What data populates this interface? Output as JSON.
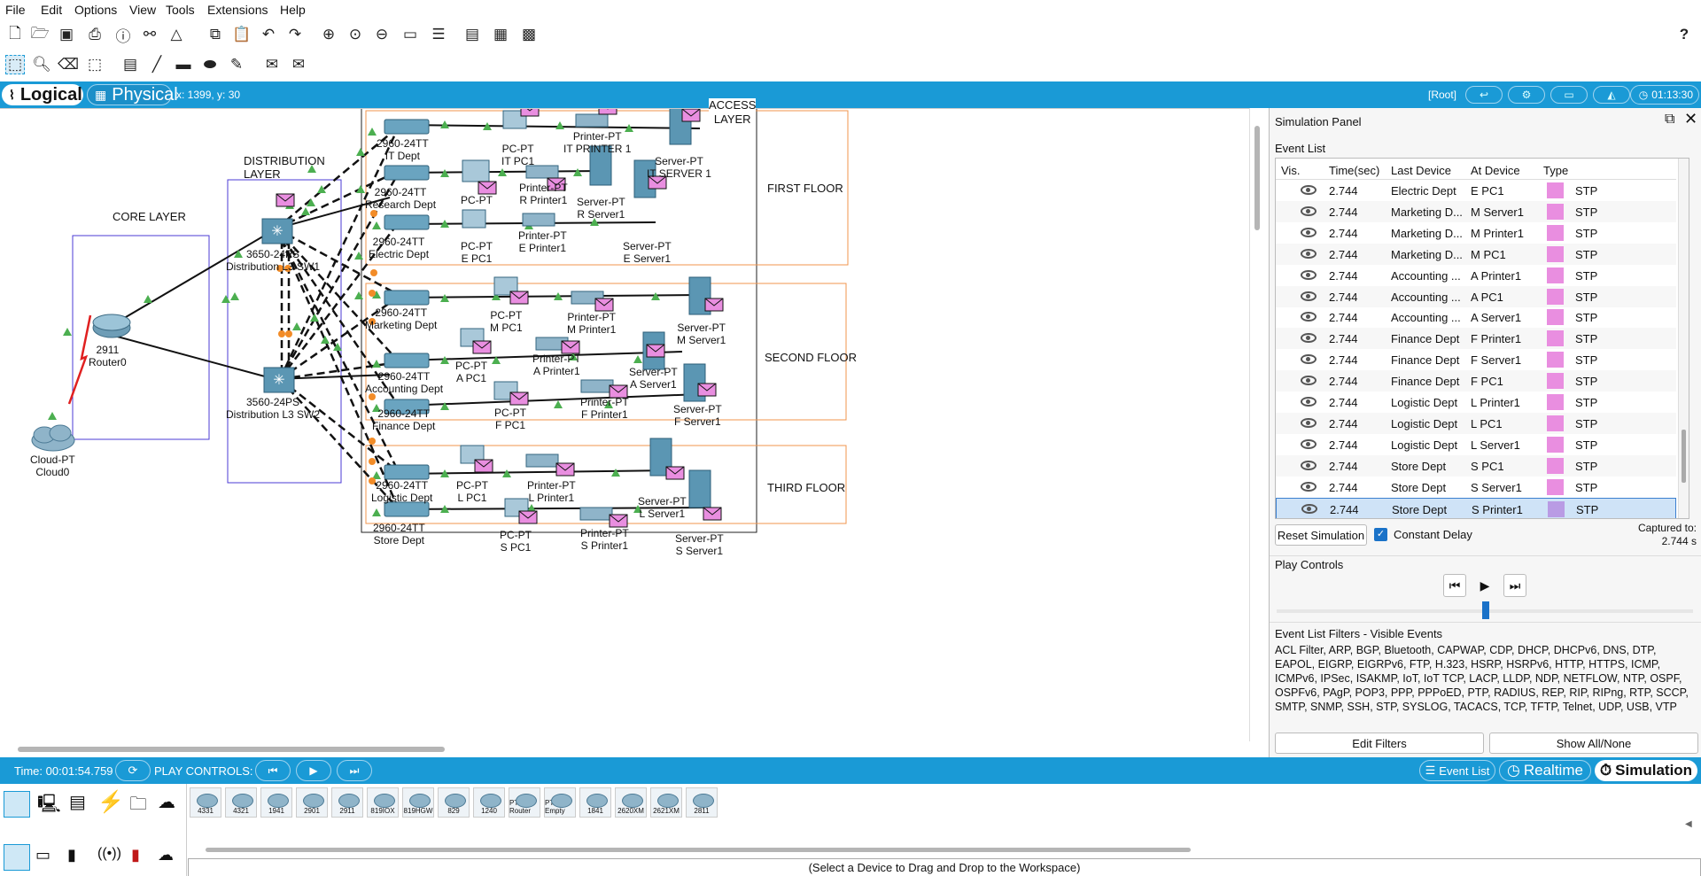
{
  "menu": [
    "File",
    "Edit",
    "Options",
    "View",
    "Tools",
    "Extensions",
    "Help"
  ],
  "help_label": "?",
  "modes": {
    "logical": "Logical",
    "physical": "Physical",
    "coords": "x: 1399, y: 30",
    "root": "[Root]",
    "clock": "01:13:30"
  },
  "workspace": {
    "areas": {
      "core": "CORE LAYER",
      "distribution": "DISTRIBUTION\nLAYER",
      "access": "ACCESS\nLAYER",
      "first": "FIRST FLOOR",
      "second": "SECOND FLOOR",
      "third": "THIRD FLOOR"
    },
    "devices": [
      {
        "type": "router",
        "label": "2911\nRouter0"
      },
      {
        "type": "cloud",
        "label": "Cloud-PT\nCloud0"
      },
      {
        "type": "l3switch",
        "label": "3650-24PS\nDistribution L3 SW1"
      },
      {
        "type": "l3switch",
        "label": "3560-24PS\nDistribution L3 SW2"
      },
      {
        "type": "switch",
        "label": "2960-24TT\nIT Dept"
      },
      {
        "type": "switch",
        "label": "2960-24TT\nResearch Dept"
      },
      {
        "type": "switch",
        "label": "2960-24TT\nElectric Dept"
      },
      {
        "type": "switch",
        "label": "2960-24TT\nMarketing Dept"
      },
      {
        "type": "switch",
        "label": "2960-24TT\nAccounting Dept"
      },
      {
        "type": "switch",
        "label": "2960-24TT\nFinance Dept"
      },
      {
        "type": "switch",
        "label": "2960-24TT\nLogistic Dept"
      },
      {
        "type": "switch",
        "label": "2960-24TT\nStore Dept"
      },
      {
        "type": "pc",
        "label": "PC-PT\nIT PC1"
      },
      {
        "type": "printer",
        "label": "Printer-PT\nIT PRINTER 1"
      },
      {
        "type": "server",
        "label": "Server-PT\nIT SERVER 1"
      },
      {
        "type": "pc",
        "label": "PC-PT"
      },
      {
        "type": "printer",
        "label": "Printer-PT\nR Printer1"
      },
      {
        "type": "server",
        "label": "Server-PT\nR Server1"
      },
      {
        "type": "pc",
        "label": "PC-PT\nE PC1"
      },
      {
        "type": "printer",
        "label": "Printer-PT\nE Printer1"
      },
      {
        "type": "server",
        "label": "Server-PT\nE Server1"
      },
      {
        "type": "pc",
        "label": "PC-PT\nM PC1"
      },
      {
        "type": "printer",
        "label": "Printer-PT\nM Printer1"
      },
      {
        "type": "server",
        "label": "Server-PT\nM Server1"
      },
      {
        "type": "pc",
        "label": "PC-PT\nA PC1"
      },
      {
        "type": "printer",
        "label": "Printer-PT\nA Printer1"
      },
      {
        "type": "server",
        "label": "Server-PT\nA Server1"
      },
      {
        "type": "pc",
        "label": "PC-PT\nF PC1"
      },
      {
        "type": "printer",
        "label": "Printer-PT\nF Printer1"
      },
      {
        "type": "server",
        "label": "Server-PT\nF Server1"
      },
      {
        "type": "pc",
        "label": "PC-PT\nL PC1"
      },
      {
        "type": "printer",
        "label": "Printer-PT\nL Printer1"
      },
      {
        "type": "server",
        "label": "Server-PT\nL Server1"
      },
      {
        "type": "pc",
        "label": "PC-PT\nS PC1"
      },
      {
        "type": "printer",
        "label": "Printer-PT\nS Printer1"
      },
      {
        "type": "server",
        "label": "Server-PT\nS Server1"
      }
    ]
  },
  "sim": {
    "title": "Simulation Panel",
    "event_list_title": "Event List",
    "columns": [
      "Vis.",
      "Time(sec)",
      "Last Device",
      "At Device",
      "Type"
    ],
    "rows": [
      {
        "time": "2.744",
        "last": "Electric Dept",
        "at": "E PC1",
        "type": "STP"
      },
      {
        "time": "2.744",
        "last": "Marketing D...",
        "at": "M Server1",
        "type": "STP"
      },
      {
        "time": "2.744",
        "last": "Marketing D...",
        "at": "M Printer1",
        "type": "STP"
      },
      {
        "time": "2.744",
        "last": "Marketing D...",
        "at": "M PC1",
        "type": "STP"
      },
      {
        "time": "2.744",
        "last": "Accounting ...",
        "at": "A Printer1",
        "type": "STP"
      },
      {
        "time": "2.744",
        "last": "Accounting ...",
        "at": "A PC1",
        "type": "STP"
      },
      {
        "time": "2.744",
        "last": "Accounting ...",
        "at": "A Server1",
        "type": "STP"
      },
      {
        "time": "2.744",
        "last": "Finance Dept",
        "at": "F Printer1",
        "type": "STP"
      },
      {
        "time": "2.744",
        "last": "Finance Dept",
        "at": "F Server1",
        "type": "STP"
      },
      {
        "time": "2.744",
        "last": "Finance Dept",
        "at": "F PC1",
        "type": "STP"
      },
      {
        "time": "2.744",
        "last": "Logistic Dept",
        "at": "L Printer1",
        "type": "STP"
      },
      {
        "time": "2.744",
        "last": "Logistic Dept",
        "at": "L PC1",
        "type": "STP"
      },
      {
        "time": "2.744",
        "last": "Logistic Dept",
        "at": "L Server1",
        "type": "STP"
      },
      {
        "time": "2.744",
        "last": "Store Dept",
        "at": "S PC1",
        "type": "STP"
      },
      {
        "time": "2.744",
        "last": "Store Dept",
        "at": "S Server1",
        "type": "STP"
      },
      {
        "time": "2.744",
        "last": "Store Dept",
        "at": "S Printer1",
        "type": "STP",
        "selected": true
      }
    ],
    "reset_label": "Reset Simulation",
    "constant_delay_label": "Constant Delay",
    "captured_label": "Captured to:",
    "captured_value": "2.744 s",
    "play_controls_label": "Play Controls",
    "filters_title": "Event List Filters - Visible Events",
    "filters_text": "ACL Filter, ARP, BGP, Bluetooth, CAPWAP, CDP, DHCP, DHCPv6, DNS, DTP, EAPOL, EIGRP, EIGRPv6, FTP, H.323, HSRP, HSRPv6, HTTP, HTTPS, ICMP, ICMPv6, IPSec, ISAKMP, IoT, IoT TCP, LACP, LLDP, NDP, NETFLOW, NTP, OSPF, OSPFv6, PAgP, POP3, PPP, PPPoED, PTP, RADIUS, REP, RIP, RIPng, RTP, SCCP, SMTP, SNMP, SSH, STP, SYSLOG, TACACS, TCP, TFTP, Telnet, UDP, USB, VTP",
    "edit_filters_label": "Edit Filters",
    "show_all_label": "Show All/None"
  },
  "bottom": {
    "time": "Time: 00:01:54.759",
    "play_controls": "PLAY CONTROLS:",
    "event_list": "Event List",
    "realtime": "Realtime",
    "simulation": "Simulation"
  },
  "devices": {
    "models": [
      "4331",
      "4321",
      "1941",
      "2901",
      "2911",
      "819IOX",
      "819HGW",
      "829",
      "1240",
      "PT-Router",
      "PT-Empty",
      "1841",
      "2620XM",
      "2621XM",
      "2811"
    ],
    "hint": "(Select a Device to Drag and Drop to the Workspace)"
  },
  "colors": {
    "accent": "#1a9ad6",
    "event_swatch": "#e98ee0",
    "floor_border": "#f0944d",
    "area_border": "#4b3bd6"
  }
}
